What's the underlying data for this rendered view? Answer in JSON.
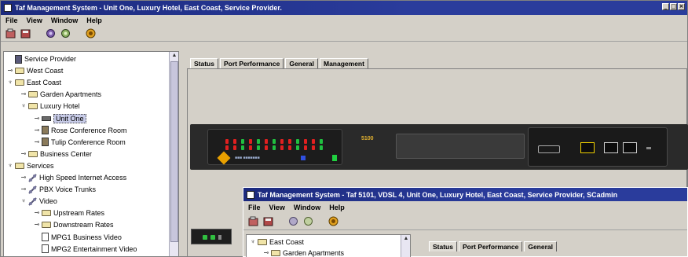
{
  "main_window": {
    "title": "Taf Management System - Unit One, Luxury Hotel, East Coast, Service Provider.",
    "menu": [
      "File",
      "View",
      "Window",
      "Help"
    ],
    "toolbar_icons": [
      "open-icon",
      "save-icon",
      "refresh-icon",
      "settings-icon",
      "alarm-icon"
    ],
    "tree": [
      {
        "label": "Service Provider",
        "level": 0,
        "icon": "root-icon",
        "expander": ""
      },
      {
        "label": "West Coast",
        "level": 0,
        "icon": "folder-icon",
        "expander": "collapsed"
      },
      {
        "label": "East Coast",
        "level": 0,
        "icon": "folder-icon",
        "expander": "expanded"
      },
      {
        "label": "Garden Apartments",
        "level": 1,
        "icon": "folder-icon",
        "expander": "collapsed"
      },
      {
        "label": "Luxury Hotel",
        "level": 1,
        "icon": "folder-icon",
        "expander": "expanded"
      },
      {
        "label": "Unit One",
        "level": 2,
        "icon": "device-icon",
        "expander": "collapsed",
        "selected": true
      },
      {
        "label": "Rose Conference Room",
        "level": 2,
        "icon": "room-icon",
        "expander": "collapsed"
      },
      {
        "label": "Tulip Conference Room",
        "level": 2,
        "icon": "room-icon",
        "expander": "collapsed"
      },
      {
        "label": "Business Center",
        "level": 1,
        "icon": "folder-icon",
        "expander": "collapsed"
      },
      {
        "label": "Services",
        "level": 0,
        "icon": "folder-icon",
        "expander": "expanded"
      },
      {
        "label": "High Speed Internet Access",
        "level": 1,
        "icon": "link-icon",
        "expander": "collapsed"
      },
      {
        "label": "PBX Voice Trunks",
        "level": 1,
        "icon": "link-icon",
        "expander": "collapsed"
      },
      {
        "label": "Video",
        "level": 1,
        "icon": "link-icon",
        "expander": "expanded"
      },
      {
        "label": "Upstream Rates",
        "level": 2,
        "icon": "folder-icon",
        "expander": "collapsed"
      },
      {
        "label": "Downstream Rates",
        "level": 2,
        "icon": "folder-icon",
        "expander": "collapsed"
      },
      {
        "label": "MPG1 Business Video",
        "level": 2,
        "icon": "doc-icon",
        "expander": ""
      },
      {
        "label": "MPG2 Entertainment Video",
        "level": 2,
        "icon": "doc-icon",
        "expander": ""
      }
    ],
    "tabs": [
      "Status",
      "Port Performance",
      "General",
      "Management"
    ],
    "active_tab": "Status",
    "device_brand": "5100",
    "window_buttons": [
      "_",
      "□",
      "×"
    ]
  },
  "second_window": {
    "title": "Taf Management System - Taf 5101, VDSL 4, Unit One, Luxury Hotel, East Coast, Service Provider, SCadmin",
    "menu": [
      "File",
      "View",
      "Window",
      "Help"
    ],
    "tree": [
      {
        "label": "East Coast",
        "level": 0,
        "icon": "folder-icon",
        "expander": "expanded"
      },
      {
        "label": "Garden Apartments",
        "level": 1,
        "icon": "folder-icon",
        "expander": "collapsed"
      }
    ],
    "tabs": [
      "Status",
      "Port Performance",
      "General"
    ],
    "active_tab": "Status"
  },
  "colors": {
    "titlebar": "#1c2a7e",
    "window_bg": "#d4d0c8",
    "scrollbar": "#e8e6f2",
    "led_red": "#e02020",
    "led_green": "#20c040",
    "port_highlight": "#f0d000"
  }
}
